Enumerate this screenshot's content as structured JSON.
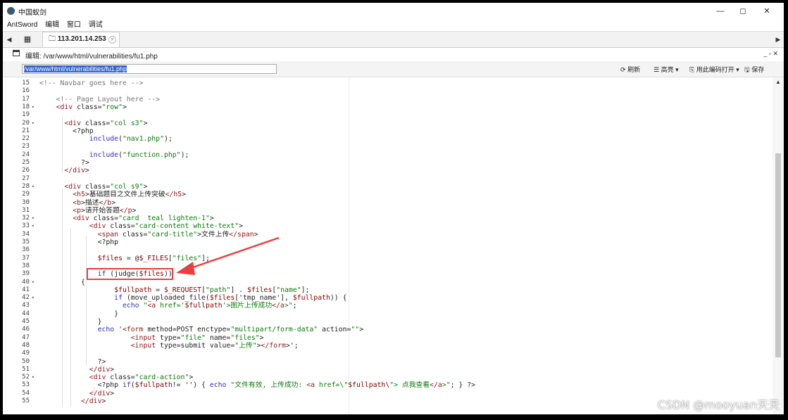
{
  "app": {
    "title": "中国蚁剑",
    "minimize": "—",
    "restore": "◻",
    "close": "✕"
  },
  "menu": [
    "AntSword",
    "编辑",
    "窗口",
    "调试"
  ],
  "tabs": {
    "host_label": "113.201.14.253"
  },
  "editor": {
    "title": "编辑: /var/www/html/vulnerabilities/fu1.php",
    "header_controls": "_ ▫ ✕",
    "path_value": "/var/www/html/vulnerabilities/fu1.php",
    "refresh_label": "刷新",
    "highlight_label": "高亮",
    "open_with_label": "用此编码打开",
    "save_label": "保存"
  },
  "code_lines": [
    {
      "n": "15",
      "fold": false,
      "text": "<!-- Navbar goes here -->"
    },
    {
      "n": "16",
      "fold": false,
      "text": ""
    },
    {
      "n": "17",
      "fold": false,
      "text": "    <!-- Page Layout here -->"
    },
    {
      "n": "18",
      "fold": true,
      "text": "    <div class=\"row\">"
    },
    {
      "n": "19",
      "fold": false,
      "text": ""
    },
    {
      "n": "20",
      "fold": true,
      "text": "      <div class=\"col s3\">"
    },
    {
      "n": "21",
      "fold": false,
      "text": "        <?php"
    },
    {
      "n": "22",
      "fold": false,
      "text": "            include(\"nav1.php\");"
    },
    {
      "n": "23",
      "fold": false,
      "text": ""
    },
    {
      "n": "24",
      "fold": false,
      "text": "            include(\"function.php\");"
    },
    {
      "n": "25",
      "fold": false,
      "text": "          ?>"
    },
    {
      "n": "26",
      "fold": false,
      "text": "      </div>"
    },
    {
      "n": "27",
      "fold": false,
      "text": ""
    },
    {
      "n": "28",
      "fold": true,
      "text": "      <div class=\"col s9\">"
    },
    {
      "n": "29",
      "fold": false,
      "text": "        <h5>基础题目之文件上传突破</h5>"
    },
    {
      "n": "30",
      "fold": false,
      "text": "        <b>描述</b>"
    },
    {
      "n": "31",
      "fold": false,
      "text": "        <p>请开始答题</p>"
    },
    {
      "n": "32",
      "fold": true,
      "text": "        <div class=\"card  teal lighten-1\">"
    },
    {
      "n": "33",
      "fold": true,
      "text": "            <div class=\"card-content white-text\">"
    },
    {
      "n": "34",
      "fold": false,
      "text": "              <span class=\"card-title\">文件上传</span>"
    },
    {
      "n": "35",
      "fold": false,
      "text": "              <?php"
    },
    {
      "n": "36",
      "fold": false,
      "text": ""
    },
    {
      "n": "37",
      "fold": false,
      "text": "              $files = @$_FILES[\"files\"];"
    },
    {
      "n": "38",
      "fold": false,
      "text": ""
    },
    {
      "n": "39",
      "fold": false,
      "text": "              if (judge($files))"
    },
    {
      "n": "40",
      "fold": true,
      "text": "          {"
    },
    {
      "n": "41",
      "fold": false,
      "text": "                  $fullpath = $_REQUEST[\"path\"] . $files[\"name\"];"
    },
    {
      "n": "42",
      "fold": true,
      "text": "                  if (move_uploaded_file($files['tmp_name'], $fullpath)) {"
    },
    {
      "n": "43",
      "fold": false,
      "text": "                    echo \"<a href='$fullpath'>图片上传成功</a>\";"
    },
    {
      "n": "44",
      "fold": false,
      "text": "                  }"
    },
    {
      "n": "45",
      "fold": false,
      "text": "              }"
    },
    {
      "n": "46",
      "fold": false,
      "text": "              echo '<form method=POST enctype=\"multipart/form-data\" action=\"\">"
    },
    {
      "n": "47",
      "fold": false,
      "text": "                      <input type=\"file\" name=\"files\">"
    },
    {
      "n": "48",
      "fold": false,
      "text": "                      <input type=submit value=\"上传\"></form>';"
    },
    {
      "n": "49",
      "fold": false,
      "text": ""
    },
    {
      "n": "50",
      "fold": false,
      "text": "              ?>"
    },
    {
      "n": "51",
      "fold": false,
      "text": "            </div>"
    },
    {
      "n": "52",
      "fold": true,
      "text": "            <div class=\"card-action\">"
    },
    {
      "n": "53",
      "fold": false,
      "text": "              <?php if($fullpath!= '') { echo \"文件有效, 上传成功: <a href=\\\"$fullpath\\\"> 点我查看</a>\"; } ?>"
    },
    {
      "n": "54",
      "fold": false,
      "text": "            </div>"
    },
    {
      "n": "55",
      "fold": false,
      "text": "          </div>"
    }
  ],
  "watermark": "CSDN @mooyuan天天",
  "colors": {
    "highlight_box": "#e84040",
    "selection": "#3366cc"
  }
}
